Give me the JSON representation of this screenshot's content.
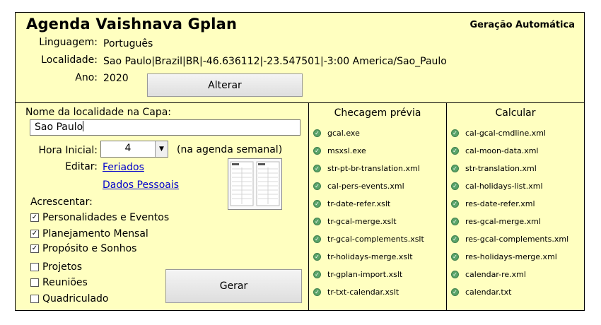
{
  "header": {
    "title": "Agenda Vaishnava Gplan",
    "subtitle": "Geração Automática",
    "language_label": "Linguagem:",
    "language_value": "Português",
    "locality_label": "Localidade:",
    "locality_value": "Sao Paulo|Brazil|BR|-46.636112|-23.547501|-3:00 America/Sao_Paulo",
    "year_label": "Ano:",
    "year_value": "2020",
    "change_button": "Alterar"
  },
  "left": {
    "cover_name_label": "Nome da localidade na Capa:",
    "cover_name_value": "Sao Paulo",
    "start_hour_label": "Hora Inicial:",
    "start_hour_value": "4",
    "start_hour_note": "(na agenda semanal)",
    "edit_label": "Editar:",
    "links": {
      "holidays": "Feriados",
      "personal": "Dados Pessoais"
    },
    "add_label": "Acrescentar:",
    "options": [
      {
        "label": "Personalidades e Eventos",
        "checked": true
      },
      {
        "label": "Planejamento Mensal",
        "checked": true
      },
      {
        "label": "Propósito e Sonhos",
        "checked": true
      },
      {
        "label": "Projetos",
        "checked": false
      },
      {
        "label": "Reuniões",
        "checked": false
      },
      {
        "label": "Quadriculado",
        "checked": false
      }
    ],
    "generate_button": "Gerar",
    "preview_icon": "calendar-preview-thumbnail"
  },
  "precheck": {
    "title": "Checagem prévia",
    "status_icon": "check-circle-icon",
    "files": [
      "gcal.exe",
      "msxsl.exe",
      "str-pt-br-translation.xml",
      "cal-pers-events.xml",
      "tr-date-refer.xslt",
      "tr-gcal-merge.xslt",
      "tr-gcal-complements.xslt",
      "tr-holidays-merge.xslt",
      "tr-gplan-import.xslt",
      "tr-txt-calendar.xslt"
    ]
  },
  "calc": {
    "title": "Calcular",
    "status_icon": "check-circle-icon",
    "files": [
      "cal-gcal-cmdline.xml",
      "cal-moon-data.xml",
      "str-translation.xml",
      "cal-holidays-list.xml",
      "res-date-refer.xml",
      "res-gcal-merge.xml",
      "res-gcal-complements.xml",
      "res-holidays-merge.xml",
      "calendar-re.xml",
      "calendar.txt"
    ]
  },
  "colors": {
    "panel_bg": "#ffffc0",
    "ok_green": "#5aa469",
    "link": "#0000cc"
  }
}
